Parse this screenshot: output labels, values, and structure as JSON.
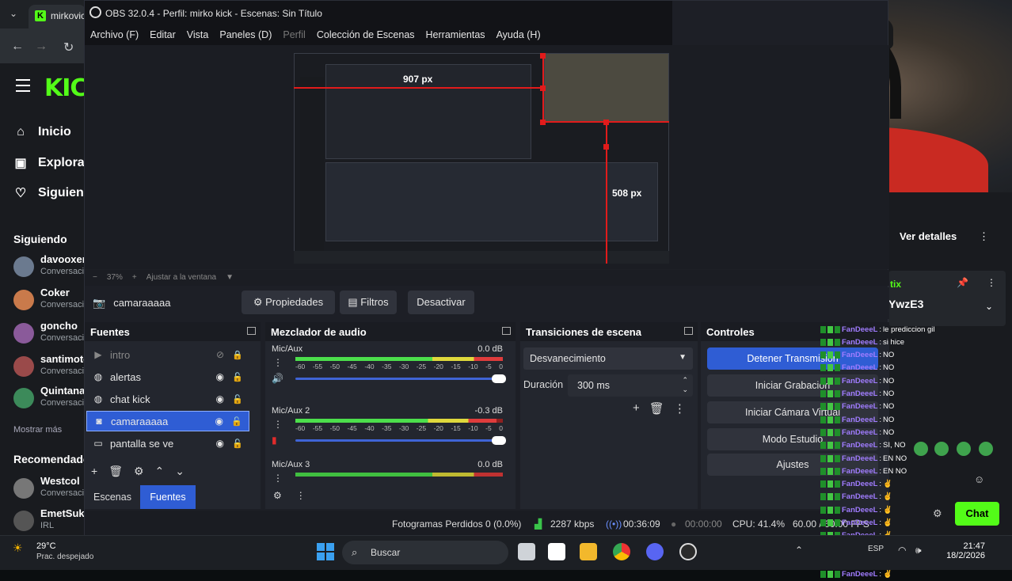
{
  "browser": {
    "tab_title": "mirkovic",
    "kick_logo": "KICK",
    "nav": [
      {
        "label": "Inicio",
        "icon": "home-icon"
      },
      {
        "label": "Explorar",
        "icon": "explore-icon"
      },
      {
        "label": "Siguiendo",
        "icon": "heart-icon"
      }
    ],
    "following_header": "Siguiendo",
    "following": [
      {
        "name": "davooxeneize",
        "category": "Conversación"
      },
      {
        "name": "Coker",
        "category": "Conversación"
      },
      {
        "name": "goncho",
        "category": "Conversación"
      },
      {
        "name": "santimotos",
        "category": "Conversación"
      },
      {
        "name": "Quintana",
        "category": "Conversación"
      }
    ],
    "show_more": "Mostrar más",
    "recommended_header": "Recomendado",
    "recommended": [
      {
        "name": "Westcol",
        "category": "Conversación"
      },
      {
        "name": "EmetSuk",
        "category": "IRL"
      }
    ],
    "ver_detalles": "Ver detalles",
    "pinned_prefix": "tix",
    "pinned_code": "YwzE3",
    "chat_button": "Chat",
    "brand_color": "#53fc18"
  },
  "obs": {
    "title": "OBS 32.0.4 - Perfil: mirko kick - Escenas: Sin Título",
    "menu": [
      "Archivo (F)",
      "Editar",
      "Vista",
      "Paneles (D)",
      "Perfil",
      "Colección de Escenas",
      "Herramientas",
      "Ayuda (H)"
    ],
    "preview_labels": {
      "width": "907 px",
      "height": "508 px"
    },
    "zoom": {
      "percent": "37%",
      "fit": "Ajustar a la ventana"
    },
    "selected_source": "camaraaaaa",
    "source_buttons": {
      "properties": "Propiedades",
      "filters": "Filtros",
      "deactivate": "Desactivar"
    },
    "sources_panel": {
      "title": "Fuentes",
      "items": [
        {
          "name": "intro",
          "icon": "play-icon"
        },
        {
          "name": "alertas",
          "icon": "globe-icon"
        },
        {
          "name": "chat kick",
          "icon": "globe-icon"
        },
        {
          "name": "camaraaaaa",
          "icon": "camera-icon"
        },
        {
          "name": "pantalla se ve",
          "icon": "monitor-icon"
        }
      ],
      "tabs": [
        "Escenas",
        "Fuentes"
      ]
    },
    "mixer": {
      "title": "Mezclador de audio",
      "ticks": [
        "-60",
        "-55",
        "-50",
        "-45",
        "-40",
        "-35",
        "-30",
        "-25",
        "-20",
        "-15",
        "-10",
        "-5",
        "0"
      ],
      "channels": [
        {
          "name": "Mic/Aux",
          "db": "0.0 dB",
          "level": 1.0
        },
        {
          "name": "Mic/Aux 2",
          "db": "-0.3 dB",
          "level": 0.97
        },
        {
          "name": "Mic/Aux 3",
          "db": "0.0 dB",
          "level": 1.0
        }
      ]
    },
    "transitions": {
      "title": "Transiciones de escena",
      "selected": "Desvanecimiento",
      "duration_label": "Duración",
      "duration_value": "300 ms"
    },
    "controls": {
      "title": "Controles",
      "buttons": [
        "Detener Transmisión",
        "Iniciar Grabación",
        "Iniciar Cámara Virtual",
        "Modo Estudio",
        "Ajustes"
      ]
    },
    "status": {
      "dropped": "Fotogramas Perdidos 0 (0.0%)",
      "bitrate": "2287 kbps",
      "stream_time": "00:36:09",
      "record_time": "00:00:00",
      "cpu": "CPU: 41.4%",
      "fps": "60.00 / 60.00 FPS"
    }
  },
  "chat_overlay": {
    "username": "FanDeeeL",
    "messages": [
      "le prediccion gil",
      "si hice",
      "NO",
      "NO",
      "NO",
      "NO",
      "NO",
      "NO",
      "NO",
      "SI, NO",
      "EN NO",
      "EN NO",
      "✌",
      "✌",
      "✌",
      "✌",
      "✌",
      "✌",
      "✌",
      "✌"
    ]
  },
  "taskbar": {
    "temperature": "29°C",
    "weather": "Prac. despejado",
    "search": "Buscar",
    "time": "21:47",
    "date": "18/2/2026",
    "lang": "ESP"
  }
}
